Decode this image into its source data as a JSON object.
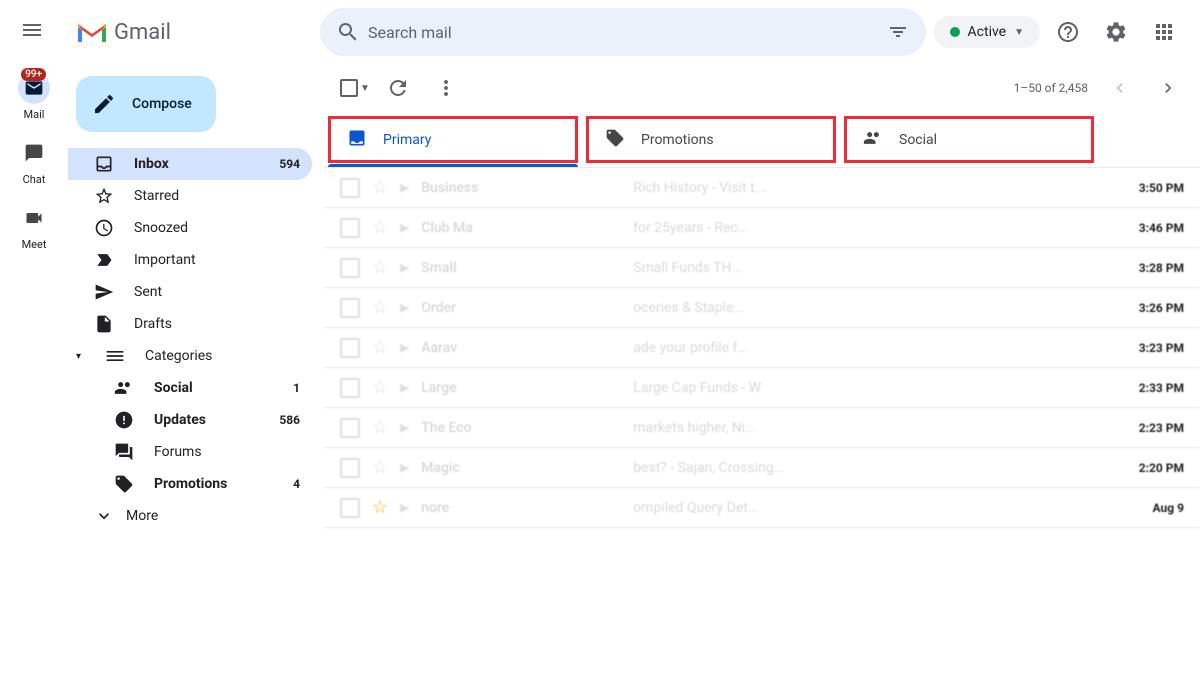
{
  "header": {
    "logo_text": "Gmail",
    "search_placeholder": "Search mail",
    "active_label": "Active"
  },
  "mini_nav": {
    "badge": "99+",
    "mail": "Mail",
    "chat": "Chat",
    "meet": "Meet"
  },
  "compose": "Compose",
  "sidebar": {
    "inbox": {
      "label": "Inbox",
      "count": "594"
    },
    "starred": "Starred",
    "snoozed": "Snoozed",
    "important": "Important",
    "sent": "Sent",
    "drafts": "Drafts",
    "categories": "Categories",
    "social": {
      "label": "Social",
      "count": "1"
    },
    "updates": {
      "label": "Updates",
      "count": "586"
    },
    "forums": "Forums",
    "promotions": {
      "label": "Promotions",
      "count": "4"
    },
    "more": "More"
  },
  "toolbar": {
    "pagination": "1–50 of 2,458"
  },
  "tabs": {
    "primary": "Primary",
    "promotions": "Promotions",
    "social": "Social"
  },
  "emails": [
    {
      "sender": "Business",
      "subject": "Rich History - Visit t...",
      "time": "3:50 PM"
    },
    {
      "sender": "Club Ma",
      "subject": "for 25years - Rec...",
      "time": "3:46 PM"
    },
    {
      "sender": "Small",
      "subject": "Small Funds TH...",
      "time": "3:28 PM"
    },
    {
      "sender": "Order",
      "subject": "oceries & Staple...",
      "time": "3:26 PM"
    },
    {
      "sender": "Aarav",
      "subject": "ade your profile f...",
      "time": "3:23 PM"
    },
    {
      "sender": "Large",
      "subject": "Large Cap Funds - W",
      "time": "2:33 PM"
    },
    {
      "sender": "The Eco",
      "subject": "markets higher, Ni...",
      "time": "2:23 PM"
    },
    {
      "sender": "Magic",
      "subject": "best? - Sajan, Crossing...",
      "time": "2:20 PM"
    },
    {
      "sender": "nore",
      "subject": "ompiled Query Det...",
      "time": "Aug 9"
    }
  ]
}
